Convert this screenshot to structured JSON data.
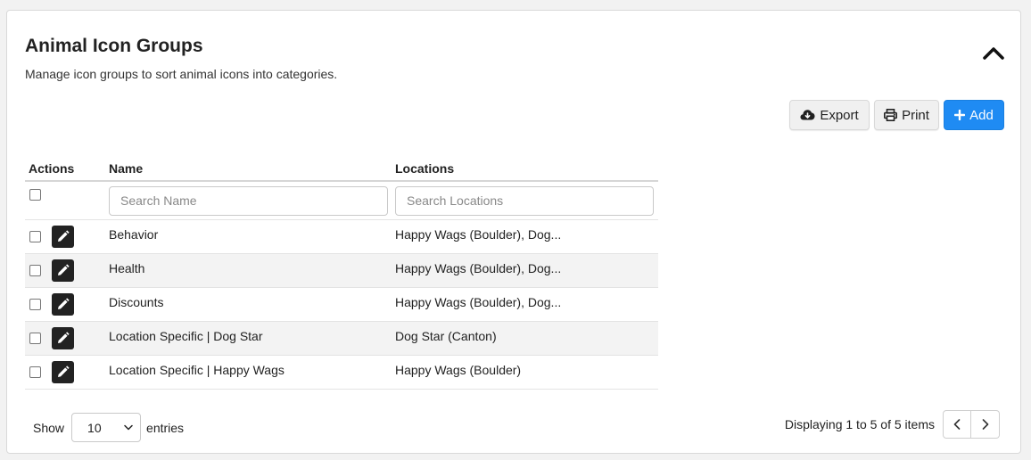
{
  "header": {
    "title": "Animal Icon Groups",
    "subtitle": "Manage icon groups to sort animal icons into categories.",
    "collapse_icon": "chevron-up-icon"
  },
  "toolbar": {
    "export_label": "Export",
    "export_icon": "cloud-download-icon",
    "print_label": "Print",
    "print_icon": "printer-icon",
    "add_label": "Add",
    "add_icon": "plus-icon"
  },
  "table": {
    "columns": [
      "Actions",
      "Name",
      "Locations"
    ],
    "search_name_placeholder": "Search Name",
    "search_locations_placeholder": "Search Locations",
    "rows": [
      {
        "name": "Behavior",
        "locations": "Happy Wags (Boulder), Dog..."
      },
      {
        "name": "Health",
        "locations": "Happy Wags (Boulder), Dog..."
      },
      {
        "name": "Discounts",
        "locations": "Happy Wags (Boulder), Dog..."
      },
      {
        "name": "Location Specific | Dog Star",
        "locations": "Dog Star (Canton)"
      },
      {
        "name": "Location Specific | Happy Wags",
        "locations": "Happy Wags (Boulder)"
      }
    ]
  },
  "footer": {
    "show_label": "Show",
    "page_size": "10",
    "entries_label": "entries",
    "displaying_text": "Displaying 1 to 5 of 5 items"
  },
  "colors": {
    "accent": "#1f8bf3",
    "edit_button": "#222222",
    "striped_row": "#f3f3f3"
  }
}
